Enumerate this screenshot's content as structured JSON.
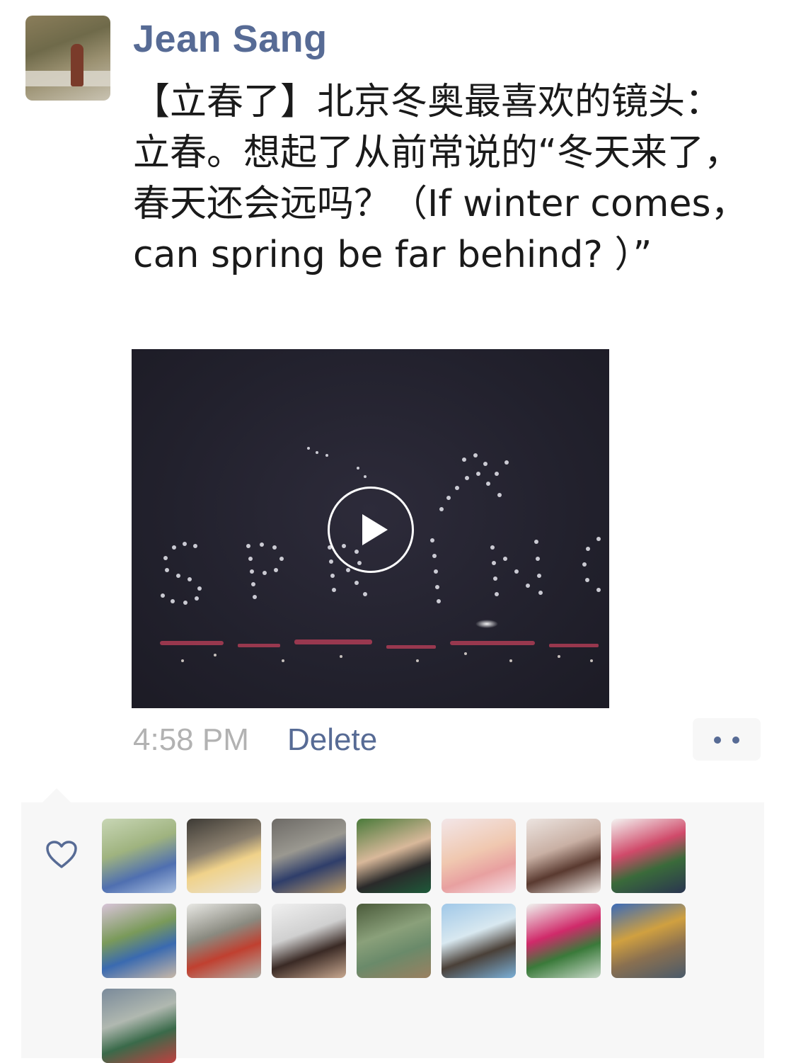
{
  "post": {
    "author": "Jean Sang",
    "text": "【立春了】北京冬奥最喜欢的镜头：立春。想起了从前常说的“冬天来了，春天还会远吗？（If winter comes， can spring be far behind? ）”",
    "time": "4:58 PM",
    "delete_label": "Delete"
  },
  "video": {
    "icon": "play-icon"
  },
  "likes": {
    "icon": "heart-icon",
    "colors": {
      "name_blue": "#576b95",
      "time_gray": "#b2b2b2",
      "panel_bg": "#f7f7f7"
    },
    "likers": [
      {
        "name": "liker-1",
        "bg": "linear-gradient(160deg,#c8d6b5 0%,#9fb37f 40%,#4f6fb0 70%,#a9bfe0 100%)"
      },
      {
        "name": "liker-2",
        "bg": "linear-gradient(160deg,#3d3a35 0%,#8a7f6e 40%,#f0d28a 60%,#e8e4dc 100%)"
      },
      {
        "name": "liker-3",
        "bg": "linear-gradient(160deg,#6d6a66 0%,#9a9890 40%,#2f3e6a 65%,#b89a6a 100%)"
      },
      {
        "name": "liker-4",
        "bg": "linear-gradient(160deg,#4a7a3a 0%,#d8b89a 45%,#2a2a2a 70%,#1e5a3a 100%)"
      },
      {
        "name": "liker-5",
        "bg": "linear-gradient(160deg,#f2e6e8 0%,#f0c8b0 45%,#e8a0a0 70%,#f6e0e6 100%)"
      },
      {
        "name": "liker-6",
        "bg": "linear-gradient(160deg,#ece4e0 0%,#c9b0a4 40%,#5a3a30 65%,#f2ece8 100%)"
      },
      {
        "name": "liker-7",
        "bg": "linear-gradient(160deg,#f4f4f2 0%,#d04a6a 40%,#3a6a3a 65%,#2a3550 100%)"
      },
      {
        "name": "liker-8",
        "bg": "linear-gradient(160deg,#d8c4d8 0%,#7a9a5a 40%,#3a6ab0 65%,#c8b8a8 100%)"
      },
      {
        "name": "liker-9",
        "bg": "linear-gradient(160deg,#e8e8e4 0%,#8a8a80 40%,#c04030 65%,#b0b0a8 100%)"
      },
      {
        "name": "liker-10",
        "bg": "linear-gradient(160deg,#f0f0f0 0%,#d0d0d0 40%,#3a2a25 65%,#c8a890 100%)"
      },
      {
        "name": "liker-11",
        "bg": "linear-gradient(160deg,#4a5a3a 0%,#8aa07a 40%,#6a8a6a 65%,#9a8060 100%)"
      },
      {
        "name": "liker-12",
        "bg": "linear-gradient(160deg,#a0c8e8 0%,#d8e8f0 40%,#4a4038 65%,#7ab0d8 100%)"
      },
      {
        "name": "liker-13",
        "bg": "linear-gradient(160deg,#f0f4f0 0%,#d02a6a 40%,#3a7a3a 65%,#c8d8c8 100%)"
      },
      {
        "name": "liker-14",
        "bg": "linear-gradient(160deg,#3a6ab8 0%,#d0a040 40%,#8a7050 65%,#4a5a6a 100%)"
      },
      {
        "name": "liker-15",
        "bg": "linear-gradient(160deg,#7a8a9a 0%,#b0b8b0 40%,#3a6a4a 65%,#c04040 100%)"
      }
    ]
  }
}
